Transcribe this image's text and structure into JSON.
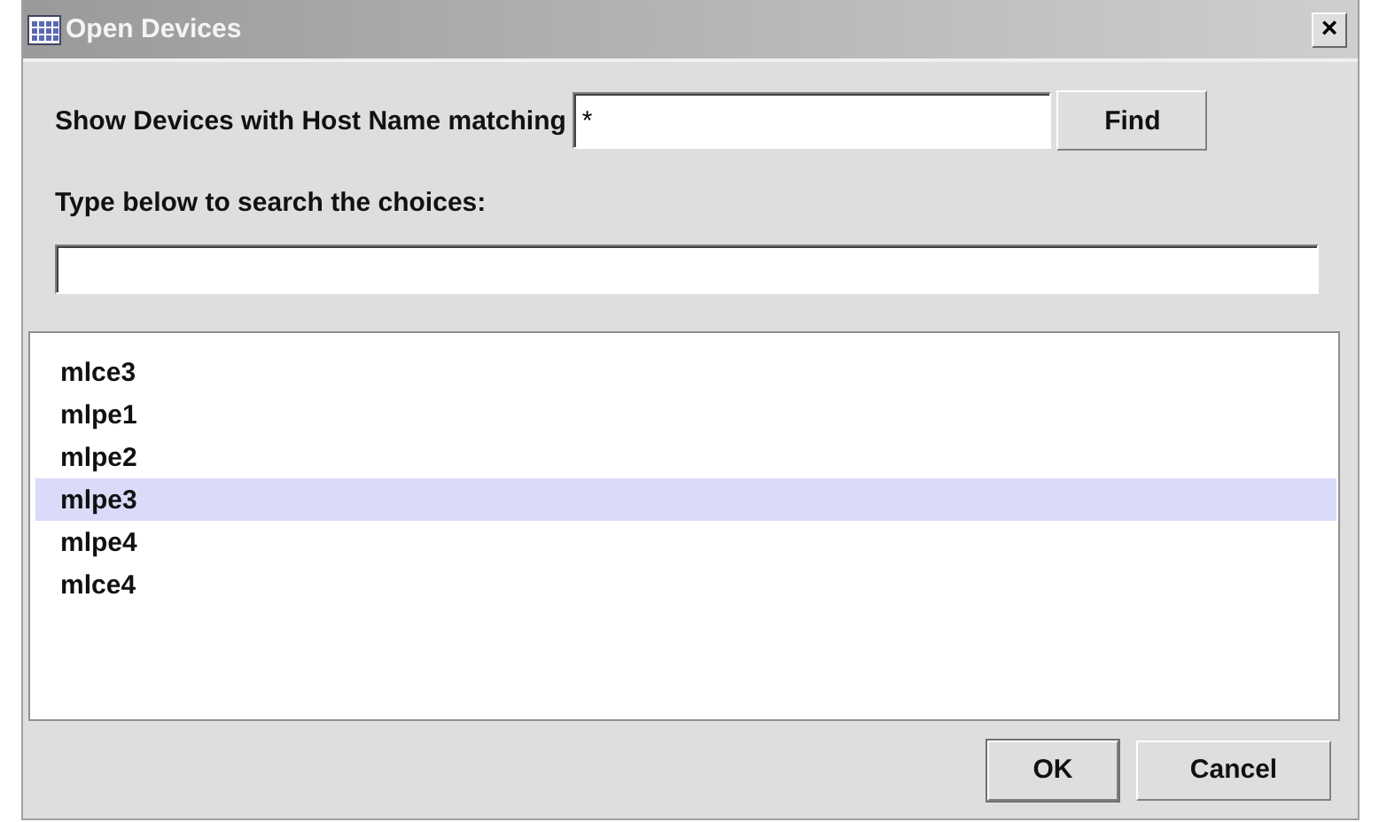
{
  "window": {
    "title": "Open Devices",
    "close": "×"
  },
  "filter": {
    "label": "Show Devices with Host Name matching",
    "value": "*",
    "button": "Find"
  },
  "search": {
    "label": "Type below to search the choices:"
  },
  "devices": [
    {
      "name": "mlce3",
      "selected": false
    },
    {
      "name": "mlpe1",
      "selected": false
    },
    {
      "name": "mlpe2",
      "selected": false
    },
    {
      "name": "mlpe3",
      "selected": true
    },
    {
      "name": "mlpe4",
      "selected": false
    },
    {
      "name": "mlce4",
      "selected": false
    }
  ],
  "buttons": [
    {
      "label": "OK",
      "default": true
    },
    {
      "label": "Cancel",
      "default": false
    }
  ]
}
